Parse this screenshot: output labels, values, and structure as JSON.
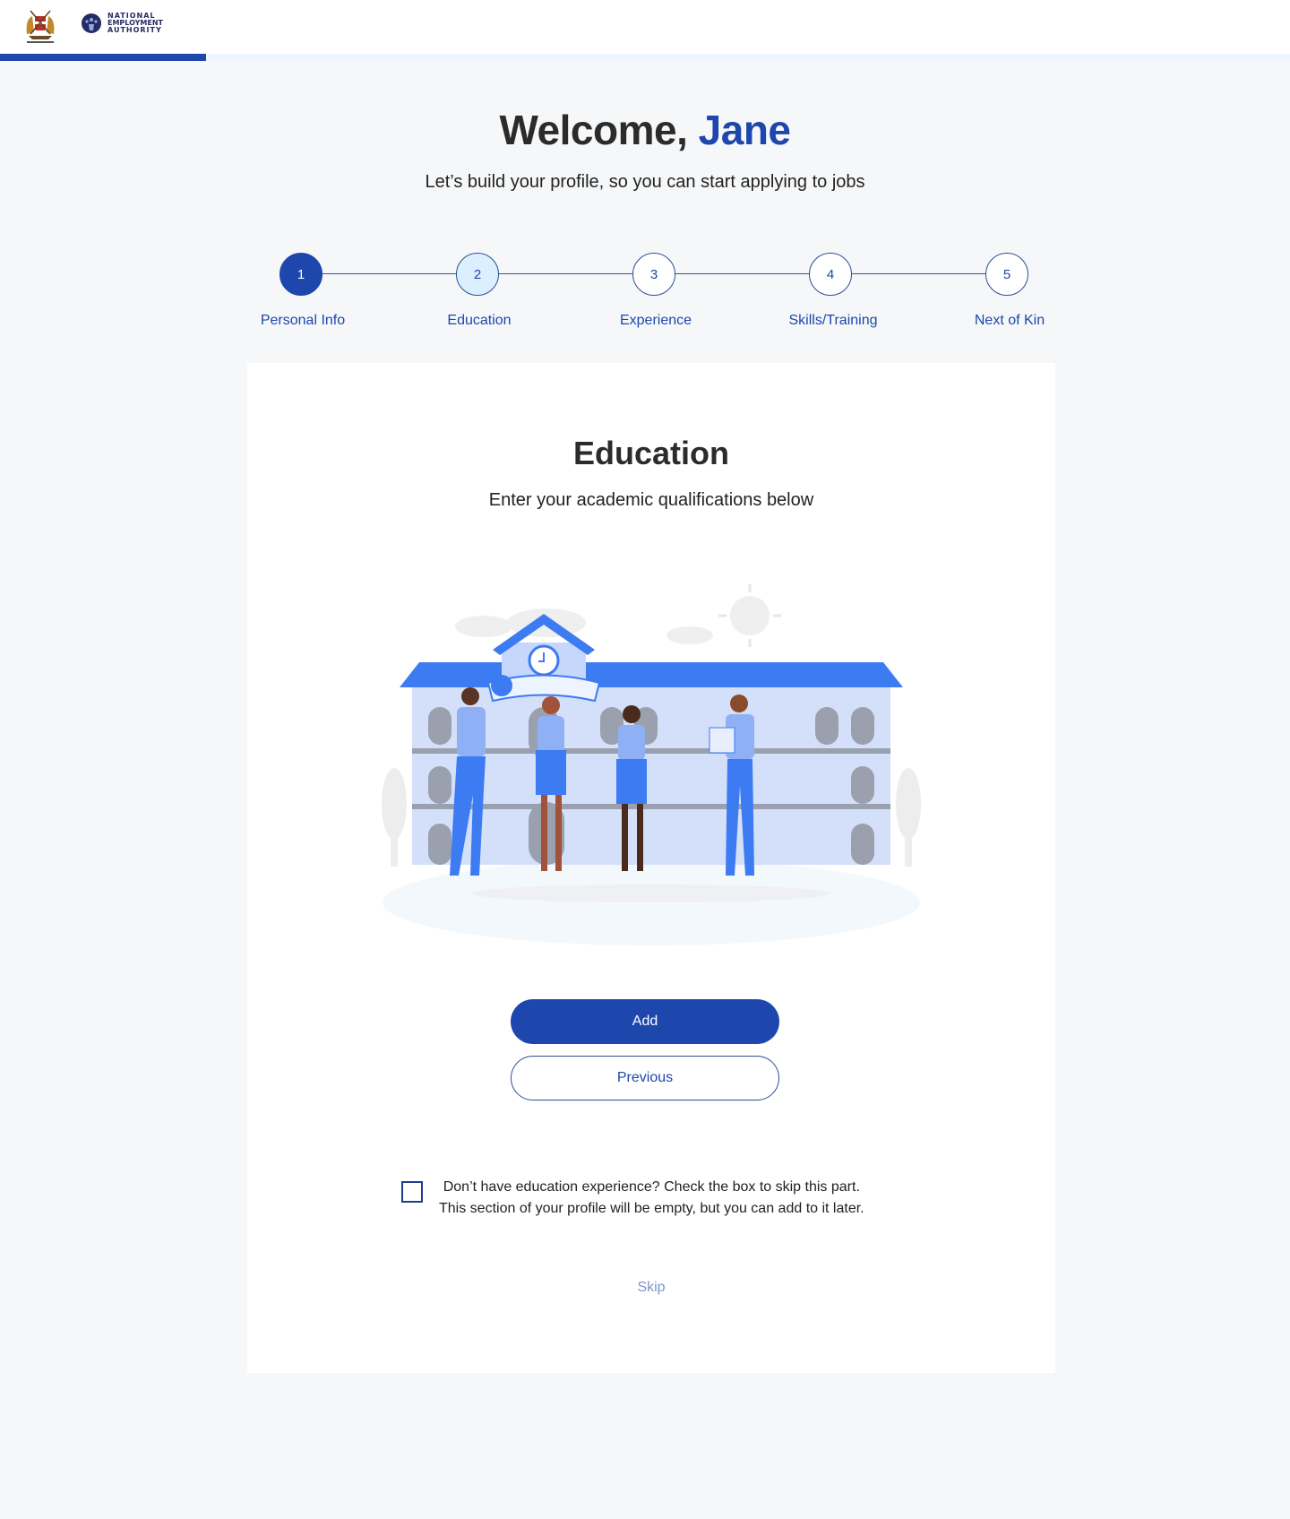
{
  "header": {
    "logo_left_alt": "Republic of Kenya coat of arms",
    "logo_right_lines": [
      "NATIONAL",
      "EMPLOYMENT",
      "AUTHORITY"
    ],
    "progress_fraction": 0.16
  },
  "welcome": {
    "greeting": "Welcome,",
    "name": "Jane",
    "subtitle": "Let’s build your profile, so you can start applying to jobs"
  },
  "stepper": {
    "steps": [
      {
        "number": "1",
        "label": "Personal Info",
        "state": "done"
      },
      {
        "number": "2",
        "label": "Education",
        "state": "current"
      },
      {
        "number": "3",
        "label": "Experience",
        "state": "upcoming"
      },
      {
        "number": "4",
        "label": "Skills/Training",
        "state": "upcoming"
      },
      {
        "number": "5",
        "label": "Next of Kin",
        "state": "upcoming"
      }
    ]
  },
  "card": {
    "title": "Education",
    "subtitle": "Enter your academic qualifications below",
    "illustration": "students-in-front-of-school-illustration",
    "add_label": "Add",
    "previous_label": "Previous",
    "skip_checkbox_checked": false,
    "skip_line1": "Don’t have education experience? Check the box to skip this part.",
    "skip_line2": "This section of your profile will be empty, but you can add to it later.",
    "skip_label": "Skip"
  },
  "colors": {
    "primary": "#1d47ac",
    "step_current_bg": "#dcefff",
    "skip_link": "#7b98c9",
    "page_bg": "#f6f7f8"
  }
}
